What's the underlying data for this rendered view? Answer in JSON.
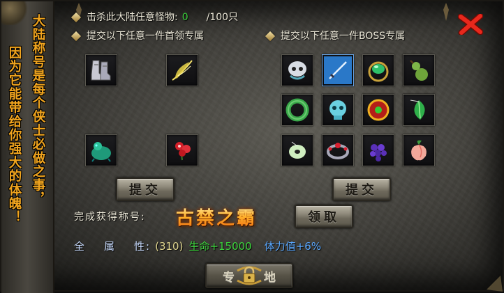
{
  "quest": {
    "kill_label": "击杀此大陆任意怪物:",
    "kill_count": "0",
    "kill_total": "/100只",
    "leader_label": "提交以下任意一件首领专属",
    "boss_label": "提交以下任意一件BOSS专属"
  },
  "slogan": {
    "col1": "大陆称号是每个侠士必做之事，",
    "col2": "因为它能带给你强大的体魄！"
  },
  "leader_items": [
    {
      "icon": "armored-boots-icon"
    },
    {
      "icon": "glowing-feather-icon"
    },
    {
      "icon": "jade-beast-icon"
    },
    {
      "icon": "red-flower-icon"
    }
  ],
  "boss_items": [
    {
      "icon": "skull-helm-icon"
    },
    {
      "icon": "blue-sword-icon"
    },
    {
      "icon": "green-gem-ring-icon"
    },
    {
      "icon": "gourd-icon"
    },
    {
      "icon": "jade-bracelet-icon"
    },
    {
      "icon": "spirit-skull-icon"
    },
    {
      "icon": "fire-orb-icon"
    },
    {
      "icon": "green-leaf-pendant-icon"
    },
    {
      "icon": "jade-disc-icon"
    },
    {
      "icon": "gem-bracelet-icon"
    },
    {
      "icon": "grape-cluster-icon"
    },
    {
      "icon": "peach-icon"
    }
  ],
  "buttons": {
    "submit_leader": "提交",
    "submit_boss": "提交",
    "claim": "领取",
    "special_a": "专",
    "special_b": "地"
  },
  "reward": {
    "title_label": "完成获得称号:",
    "title_name": "古禁之霸",
    "attr_label_a": "全",
    "attr_label_b": "属",
    "attr_label_c": "性:",
    "attr_value": "(310)",
    "hp_bonus": "生命+15000",
    "stamina_bonus": "体力值+6%"
  },
  "colors": {
    "slogan": "#f0a41e",
    "count": "#3cd23c",
    "title": "#ffb02a",
    "stamina": "#5aa8ff"
  }
}
